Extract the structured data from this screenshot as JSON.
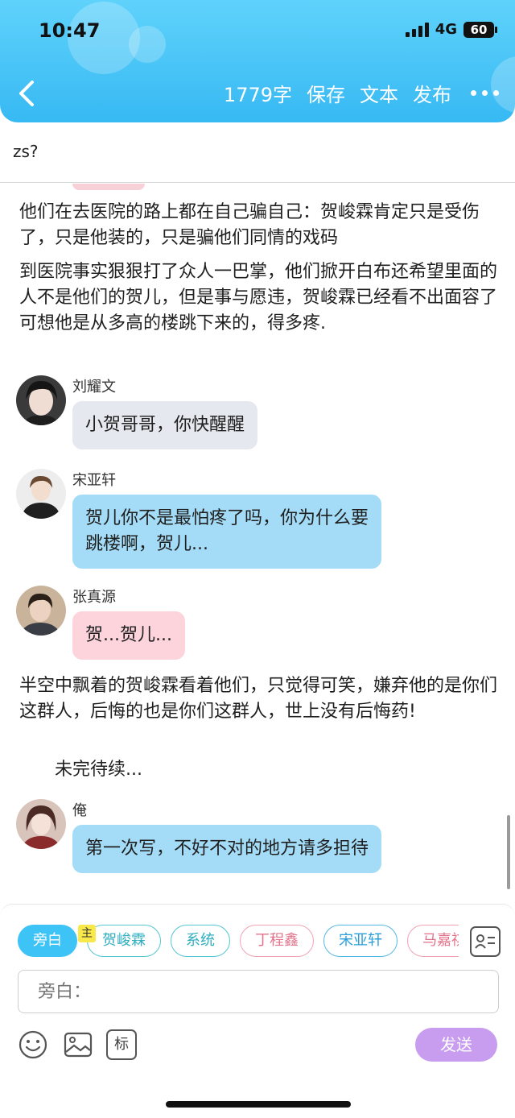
{
  "status_bar": {
    "time": "10:47",
    "network": "4G",
    "battery": "60"
  },
  "header": {
    "word_count": "1779字",
    "save_label": "保存",
    "text_label": "文本",
    "publish_label": "发布"
  },
  "title": "zs?",
  "content": {
    "para1": "他们在去医院的路上都在自己骗自己：贺峻霖肯定只是受伤了，只是他装的，只是骗他们同情的戏码",
    "para2": "到医院事实狠狠打了众人一巴掌，他们掀开白布还希望里面的人不是他们的贺儿，但是事与愿违，贺峻霖已经看不出面容了可想他是从多高的楼跳下来的，得多疼.",
    "messages": [
      {
        "name": "刘耀文",
        "text": "小贺哥哥，你快醒醒"
      },
      {
        "name": "宋亚轩",
        "text": "贺儿你不是最怕疼了吗，你为什么要跳楼啊，贺儿..."
      },
      {
        "name": "张真源",
        "text": "贺...贺儿..."
      }
    ],
    "para3": "半空中飘着的贺峻霖看着他们，只觉得可笑，嫌弃他的是你们这群人，后悔的也是你们这群人，世上没有后悔药!",
    "para4": "未完待续...",
    "author_message": {
      "name": "俺",
      "text": "第一次写，不好不对的地方请多担待"
    }
  },
  "composer": {
    "chips": [
      "旁白",
      "贺峻霖",
      "系统",
      "丁程鑫",
      "宋亚轩",
      "马嘉祺"
    ],
    "main_badge": "主",
    "input_placeholder": "旁白：",
    "tool_tag_label": "标",
    "send_label": "发送"
  },
  "colors": {
    "header": "#37b9f3",
    "bubble_gray": "#e5e8ee",
    "bubble_blue": "#a4dcf7",
    "bubble_pink": "#fdd4dc",
    "send_button": "#c89df0"
  }
}
